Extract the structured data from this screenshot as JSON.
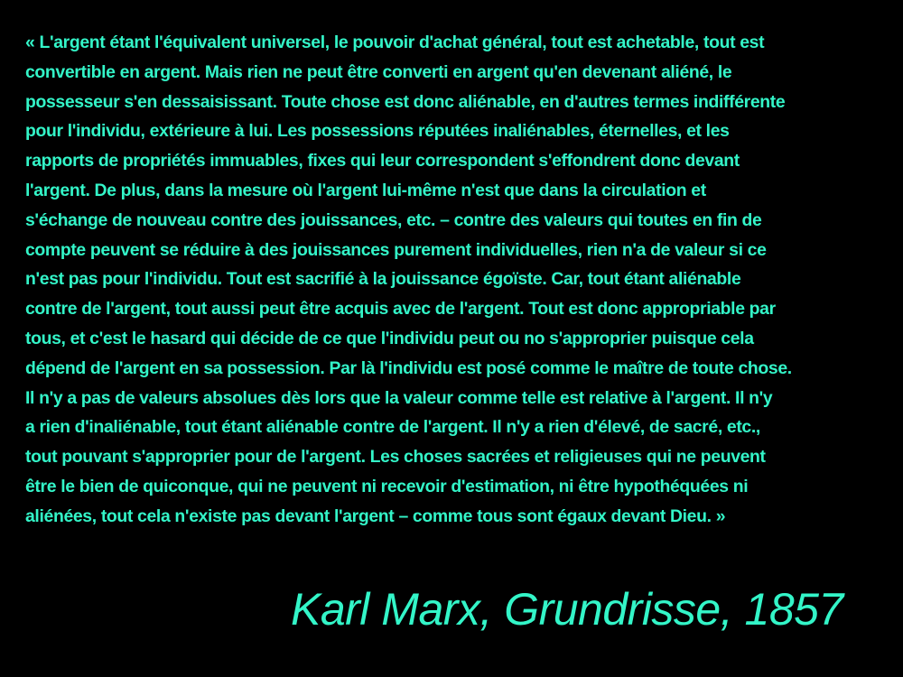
{
  "colors": {
    "background": "#000000",
    "text": "#33f5c8"
  },
  "quote": {
    "lines": [
      "« L'argent étant l'équivalent universel, le pouvoir d'achat général, tout est achetable, tout est",
      "convertible en argent. Mais rien ne peut être converti en argent qu'en devenant aliéné, le",
      "possesseur s'en dessaisissant. Toute chose est donc aliénable, en d'autres termes indifférente",
      "pour l'individu, extérieure à lui. Les possessions réputées inaliénables, éternelles, et les",
      "rapports de propriétés immuables, fixes qui leur correspondent s'effondrent donc devant",
      "l'argent. De plus, dans la mesure où l'argent lui-même n'est que dans la circulation et",
      "s'échange de nouveau contre des jouissances, etc. – contre des valeurs qui toutes en fin de",
      "compte peuvent se réduire à des jouissances purement individuelles, rien n'a de valeur si ce",
      "n'est pas pour l'individu. Tout est sacrifié à la jouissance égoïste. Car, tout étant aliénable",
      "contre de l'argent, tout aussi peut être acquis avec de l'argent. Tout est donc appropriable par",
      "tous, et c'est le hasard qui décide de ce que l'individu peut ou no s'approprier puisque cela",
      "dépend de l'argent en sa possession. Par là l'individu est posé comme le maître de toute chose.",
      "Il n'y a pas de valeurs absolues dès lors que la valeur comme telle est relative à l'argent. Il n'y",
      "a rien d'inaliénable, tout étant aliénable contre de l'argent. Il n'y a rien d'élevé, de sacré, etc.,",
      "tout pouvant s'approprier pour de l'argent. Les choses sacrées et religieuses qui ne peuvent",
      "être le bien de quiconque, qui ne peuvent ni recevoir d'estimation, ni être hypothéquées ni",
      "aliénées, tout cela n'existe pas devant l'argent – comme tous sont égaux devant Dieu. »"
    ]
  },
  "attribution": "Karl Marx, Grundrisse, 1857"
}
